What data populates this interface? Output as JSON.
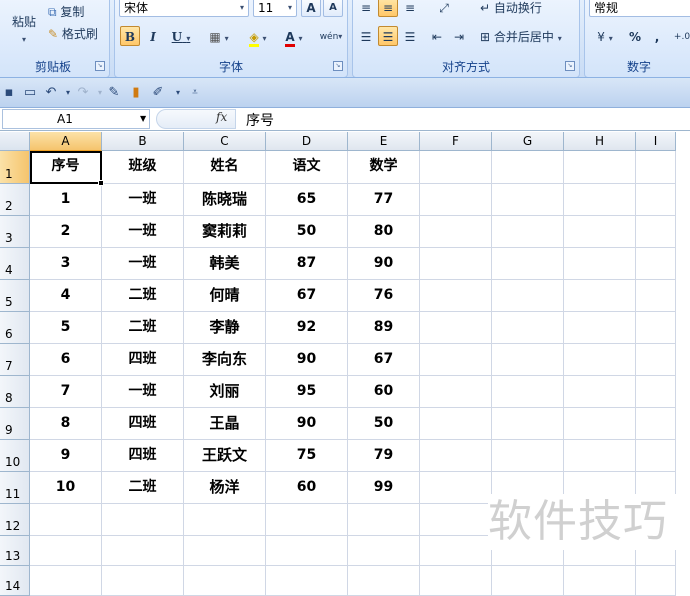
{
  "ribbon": {
    "clipboard": {
      "paste_label": "粘贴",
      "copy_label": "复制",
      "format_painter_label": "格式刷",
      "group_label": "剪贴板"
    },
    "font": {
      "font_name": "宋体",
      "font_size": "11",
      "group_label": "字体",
      "bold": "B",
      "italic": "I",
      "underline": "U",
      "grow": "A",
      "shrink": "A",
      "phonetic": "wén"
    },
    "alignment": {
      "wrap_text_label": "自动换行",
      "merge_center_label": "合并后居中",
      "group_label": "对齐方式"
    },
    "number": {
      "format": "常规",
      "percent": "%",
      "comma": ",",
      "group_label": "数字"
    }
  },
  "formula_bar": {
    "name_box": "A1",
    "fx_label": "fx",
    "formula": "序号"
  },
  "columns": [
    "A",
    "B",
    "C",
    "D",
    "E",
    "F",
    "G",
    "H",
    "I"
  ],
  "rows": [
    "1",
    "2",
    "3",
    "4",
    "5",
    "6",
    "7",
    "8",
    "9",
    "10",
    "11",
    "12",
    "13",
    "14"
  ],
  "table": {
    "headers": [
      "序号",
      "班级",
      "姓名",
      "语文",
      "数学"
    ],
    "data": [
      [
        "1",
        "一班",
        "陈晓瑞",
        "65",
        "77"
      ],
      [
        "2",
        "一班",
        "窦莉莉",
        "50",
        "80"
      ],
      [
        "3",
        "一班",
        "韩美",
        "87",
        "90"
      ],
      [
        "4",
        "二班",
        "何晴",
        "67",
        "76"
      ],
      [
        "5",
        "二班",
        "李静",
        "92",
        "89"
      ],
      [
        "6",
        "四班",
        "李向东",
        "90",
        "67"
      ],
      [
        "7",
        "一班",
        "刘丽",
        "95",
        "60"
      ],
      [
        "8",
        "四班",
        "王晶",
        "90",
        "50"
      ],
      [
        "9",
        "四班",
        "王跃文",
        "75",
        "79"
      ],
      [
        "10",
        "二班",
        "杨洋",
        "60",
        "99"
      ]
    ]
  },
  "watermark": "软件技巧",
  "colors": {
    "selection_orange": "#f5c46d",
    "ribbon_blue": "#c9dcf5",
    "gridline": "#d0d7e5"
  }
}
